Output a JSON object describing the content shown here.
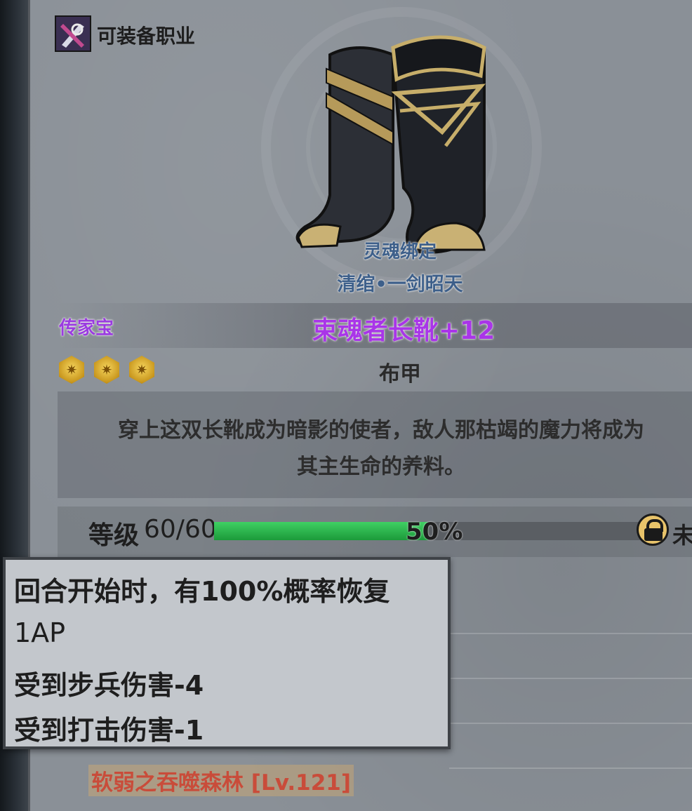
{
  "header": {
    "class_label": "可装备职业"
  },
  "item": {
    "soulbound": "灵魂绑定",
    "owner": "清绾•一剑昭天",
    "rarity": "传家宝",
    "name": "束魂者长靴+12",
    "armor_type": "布甲",
    "stars": 3,
    "description_line1": "穿上这双长靴成为暗影的使者，敌人那枯竭的魔力将成为",
    "description_line2": "其主生命的养料。"
  },
  "level": {
    "label": "等级",
    "value": "60/60",
    "progress_text": "50%",
    "progress": 0.5,
    "lock_text": "未"
  },
  "tooltip": {
    "line1": "回合开始时，有100%概率恢复",
    "line2": "1AP",
    "line3": "受到步兵伤害-4",
    "line4": "受到打击伤害-1"
  },
  "source": {
    "text": "软弱之吞噬森林 [Lv.121]"
  },
  "colors": {
    "rarity": "#a935e8",
    "soulbound": "#3d5f8a",
    "progress_fill": "#2fb54e",
    "source": "#c94c3a"
  },
  "icons": [
    "class-icon",
    "boots-icon",
    "star-icon",
    "lock-icon"
  ]
}
